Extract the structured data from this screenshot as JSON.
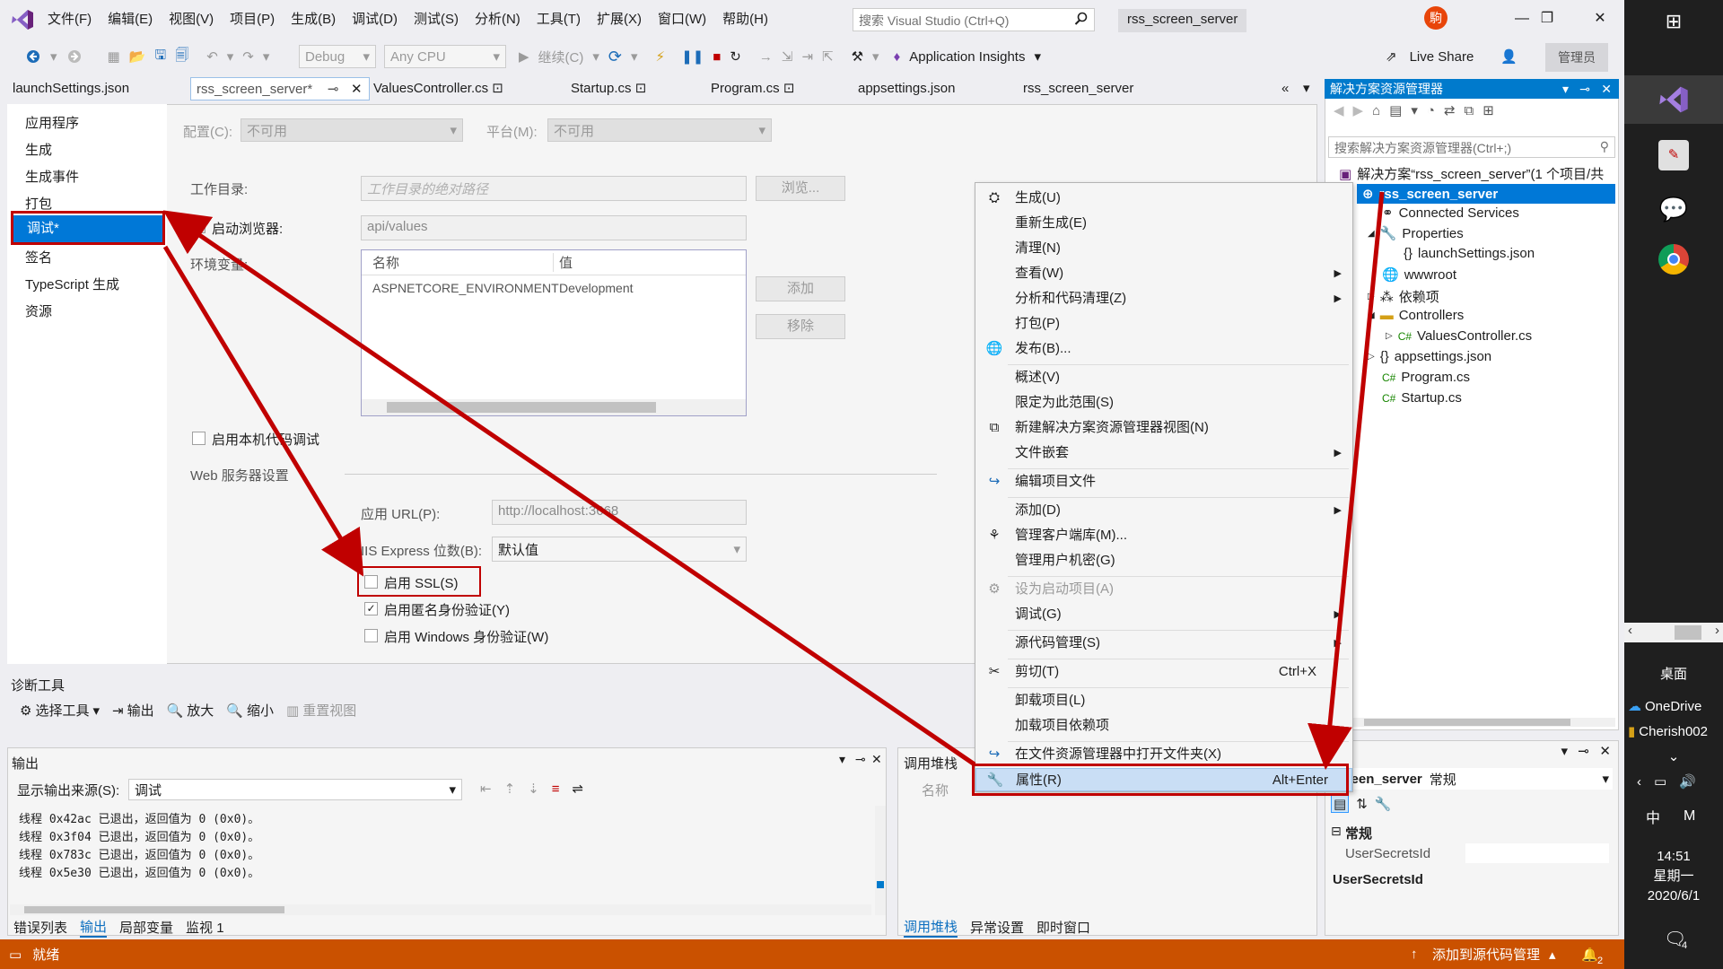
{
  "menubar": {
    "items": [
      "文件(F)",
      "编辑(E)",
      "视图(V)",
      "项目(P)",
      "生成(B)",
      "调试(D)",
      "测试(S)",
      "分析(N)",
      "工具(T)",
      "扩展(X)",
      "窗口(W)",
      "帮助(H)"
    ],
    "search_placeholder": "搜索 Visual Studio (Ctrl+Q)",
    "solution_title": "rss_screen_server",
    "avatar_text": "駒"
  },
  "toolbar": {
    "config": "Debug",
    "platform": "Any CPU",
    "continue_label": "继续(C)",
    "app_insights": "Application Insights",
    "live_share": "Live Share",
    "admin": "管理员"
  },
  "tabs": [
    "launchSettings.json",
    "rss_screen_server*",
    "ValuesController.cs",
    "Startup.cs",
    "Program.cs",
    "appsettings.json",
    "rss_screen_server"
  ],
  "prop_pages": {
    "nav": [
      "应用程序",
      "生成",
      "生成事件",
      "打包",
      "调试*",
      "签名",
      "TypeScript 生成",
      "资源"
    ],
    "config_label": "配置(C):",
    "config_value": "不可用",
    "platform_label": "平台(M):",
    "platform_value": "不可用",
    "workdir_label": "工作目录:",
    "workdir_placeholder": "工作目录的绝对路径",
    "browse_button": "浏览...",
    "launch_browser_label": "启动浏览器:",
    "launch_browser_value": "api/values",
    "env_label": "环境变量:",
    "env_headers": [
      "名称",
      "值"
    ],
    "env_rows": [
      [
        "ASPNETCORE_ENVIRONMENT",
        "Development"
      ]
    ],
    "add_button": "添加",
    "remove_button": "移除",
    "native_debug_label": "启用本机代码调试",
    "web_server_section": "Web 服务器设置",
    "app_url_label": "应用 URL(P):",
    "app_url_value": "http://localhost:3668",
    "iis_bitness_label": "IIS Express 位数(B):",
    "iis_bitness_value": "默认值",
    "ssl_label": "启用 SSL(S)",
    "anon_auth_label": "启用匿名身份验证(Y)",
    "windows_auth_label": "启用 Windows 身份验证(W)"
  },
  "context_menu": {
    "items": [
      {
        "label": "生成(U)",
        "icon": "build-icon"
      },
      {
        "label": "重新生成(E)"
      },
      {
        "label": "清理(N)"
      },
      {
        "label": "查看(W)",
        "submenu": true
      },
      {
        "label": "分析和代码清理(Z)",
        "submenu": true
      },
      {
        "label": "打包(P)"
      },
      {
        "label": "发布(B)...",
        "icon": "globe-icon"
      },
      {
        "label": "概述(V)"
      },
      {
        "label": "限定为此范围(S)"
      },
      {
        "label": "新建解决方案资源管理器视图(N)",
        "icon": "new-view-icon"
      },
      {
        "label": "文件嵌套",
        "submenu": true
      },
      {
        "label": "编辑项目文件",
        "icon": "edit-icon"
      },
      {
        "label": "添加(D)",
        "submenu": true
      },
      {
        "label": "管理客户端库(M)...",
        "icon": "library-icon"
      },
      {
        "label": "管理用户机密(G)"
      },
      {
        "label": "设为启动项目(A)",
        "disabled": true,
        "icon": "gear-icon"
      },
      {
        "label": "调试(G)",
        "submenu": true
      },
      {
        "label": "源代码管理(S)",
        "submenu": true
      },
      {
        "label": "剪切(T)",
        "shortcut": "Ctrl+X",
        "icon": "scissors-icon"
      },
      {
        "label": "卸载项目(L)"
      },
      {
        "label": "加载项目依赖项"
      },
      {
        "label": "在文件资源管理器中打开文件夹(X)",
        "icon": "refresh-icon"
      },
      {
        "label": "属性(R)",
        "shortcut": "Alt+Enter",
        "icon": "wrench-icon",
        "highlighted": true
      }
    ]
  },
  "solution_explorer": {
    "title": "解决方案资源管理器",
    "search_placeholder": "搜索解决方案资源管理器(Ctrl+;)",
    "solution_node": "解决方案“rss_screen_server”(1 个项目/共",
    "project_node": "rss_screen_server",
    "items": [
      "Connected Services",
      "Properties",
      "launchSettings.json",
      "wwwroot",
      "依赖项",
      "Controllers",
      "ValuesController.cs",
      "appsettings.json",
      "Program.cs",
      "Startup.cs"
    ]
  },
  "diagnostics": {
    "title": "诊断工具",
    "select_tool": "选择工具",
    "output_btn": "输出",
    "zoom_in": "放大",
    "zoom_out": "缩小",
    "reset_view": "重置视图"
  },
  "output": {
    "title": "输出",
    "source_label": "显示输出来源(S):",
    "source_value": "调试",
    "lines": [
      "线程 0x42ac 已退出，返回值为 0 (0x0)。",
      "线程 0x3f04 已退出，返回值为 0 (0x0)。",
      "线程 0x783c 已退出，返回值为 0 (0x0)。",
      "线程 0x5e30 已退出，返回值为 0 (0x0)。"
    ],
    "tabs": [
      "错误列表",
      "输出",
      "局部变量",
      "监视 1"
    ]
  },
  "callstack": {
    "title": "调用堆栈",
    "col_name": "名称",
    "tabs": [
      "调用堆栈",
      "异常设置",
      "即时窗口"
    ]
  },
  "properties": {
    "object": "screen_server",
    "object_type": "常规",
    "category": "常规",
    "prop_name": "UserSecretsId",
    "desc_title": "UserSecretsId"
  },
  "status": {
    "ready": "就绪",
    "source_control": "添加到源代码管理",
    "notifications": "2"
  },
  "taskbar": {
    "desktop": "桌面",
    "onedrive": "OneDrive",
    "user": "Cherish002",
    "ime": "中",
    "time": "14:51",
    "weekday": "星期一",
    "date": "2020/6/1",
    "notif_count": "4"
  },
  "colors": {
    "accent": "#007acc",
    "status": "#ca5100",
    "annotation": "#c00000",
    "selection": "#0078d7"
  }
}
